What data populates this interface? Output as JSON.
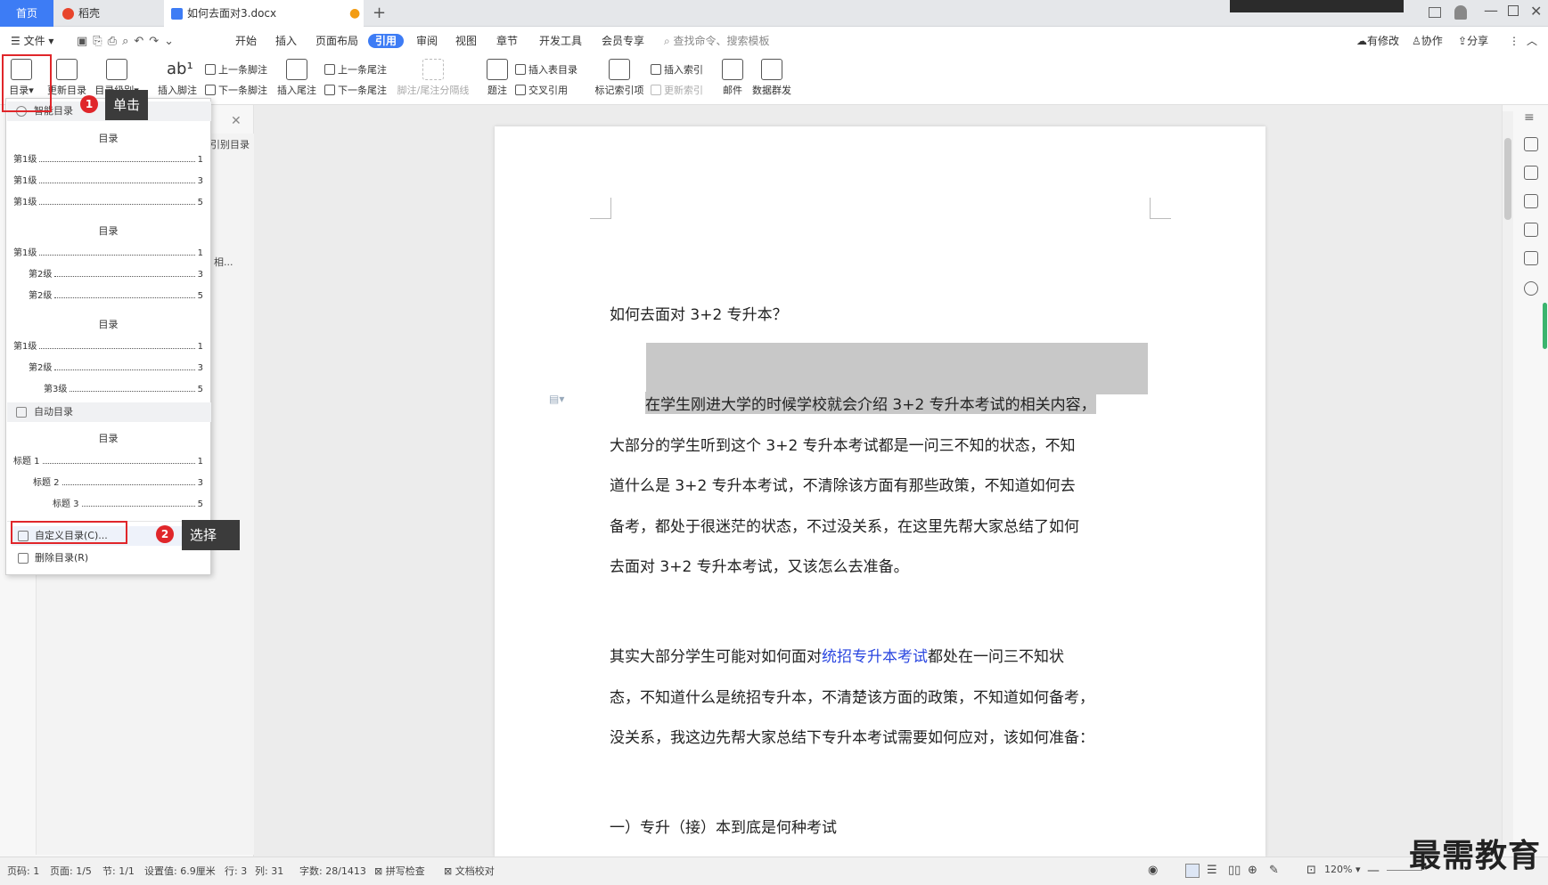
{
  "tabbar": {
    "home": "首页",
    "tabs": [
      {
        "label": "稻壳",
        "icon": "daoke-icon"
      },
      {
        "label": "如何去面对3.docx",
        "icon": "word-doc-icon"
      }
    ],
    "add": "+"
  },
  "menubar": {
    "file": "文件",
    "items": [
      "开始",
      "插入",
      "页面布局",
      "引用",
      "审阅",
      "视图",
      "章节",
      "开发工具",
      "会员专享"
    ],
    "active": "引用",
    "search_placeholder": "查找命令、搜索模板",
    "right": [
      "有修改",
      "协作",
      "分享"
    ]
  },
  "ribbon": {
    "toc": "目录",
    "update_toc": "更新目录",
    "toc_level": "目录级别",
    "insert_footnote": "插入脚注",
    "prev_footnote": "上一条脚注",
    "next_footnote": "下一条脚注",
    "insert_endnote": "插入尾注",
    "prev_endnote": "上一条尾注",
    "next_endnote": "下一条尾注",
    "footnote_sep": "脚注/尾注分隔线",
    "caption": "题注",
    "insert_table_toc": "插入表目录",
    "cross_ref": "交叉引用",
    "mark_index": "标记索引项",
    "insert_index": "插入索引",
    "update_index": "更新索引",
    "mail": "邮件",
    "data_mass": "数据群发"
  },
  "leftpane": {
    "partial1": "引别目录",
    "partial2": "相..."
  },
  "dropdown": {
    "smart_toc": "智能目录",
    "toc1": {
      "title": "目录",
      "lines": [
        {
          "label": "第1级",
          "page": "1"
        },
        {
          "label": "第1级",
          "page": "3"
        },
        {
          "label": "第1级",
          "page": "5"
        }
      ]
    },
    "toc2": {
      "title": "目录",
      "lines": [
        {
          "label": "第1级",
          "page": "1"
        },
        {
          "label": "第2级",
          "page": "3"
        },
        {
          "label": "第2级",
          "page": "5"
        }
      ]
    },
    "toc3": {
      "title": "目录",
      "lines": [
        {
          "label": "第1级",
          "page": "1"
        },
        {
          "label": "第2级",
          "page": "3"
        },
        {
          "label": "第3级",
          "page": "5"
        }
      ]
    },
    "auto_toc": "自动目录",
    "toc4": {
      "title": "目录",
      "lines": [
        {
          "label": "标题 1",
          "page": "1"
        },
        {
          "label": "标题 2",
          "page": "3"
        },
        {
          "label": "标题 3",
          "page": "5"
        }
      ]
    },
    "custom_toc": "自定义目录(C)...",
    "delete_toc": "删除目录(R)"
  },
  "callouts": {
    "step1_num": "1",
    "step1": "单击",
    "step2_num": "2",
    "step2": "选择"
  },
  "document": {
    "title": "如何去面对 3+2 专升本？",
    "p1": [
      "在学生刚进大学的时候学校就会介绍 3+2 专升本考试的相关内容，",
      "大部分的学生听到这个 3+2 专升本考试都是一问三不知的状态，不知",
      "道什么是 3+2 专升本考试，不清除该方面有那些政策，不知道如何去",
      "备考，都处于很迷茫的状态，不过没关系，在这里先帮大家总结了如何",
      "去面对 3+2 专升本考试，又该怎么去准备。"
    ],
    "p2_pre": "其实大部分学生可能对如何面对",
    "p2_link": "统招专升本考试",
    "p2_post": "都处在一问三不知状",
    "p2_lines": [
      "态，不知道什么是统招专升本，不清楚该方面的政策，不知道如何备考，",
      "没关系，我这边先帮大家总结下专升本考试需要如何应对，该如何准备："
    ],
    "heading": "一）专升（接）本到底是何种考试"
  },
  "status": {
    "page_code": "页码: 1",
    "page": "页面: 1/5",
    "section": "节: 1/1",
    "setting": "设置值: 6.9厘米",
    "row": "行: 3",
    "col": "列: 31",
    "words": "字数: 28/1413",
    "spell": "拼写检查",
    "proof": "文档校对",
    "zoom": "120%"
  },
  "watermark": "最需教育",
  "colors": {
    "accent": "#3d7cf5",
    "callout_red": "#e0262a",
    "link": "#2a46e0"
  }
}
